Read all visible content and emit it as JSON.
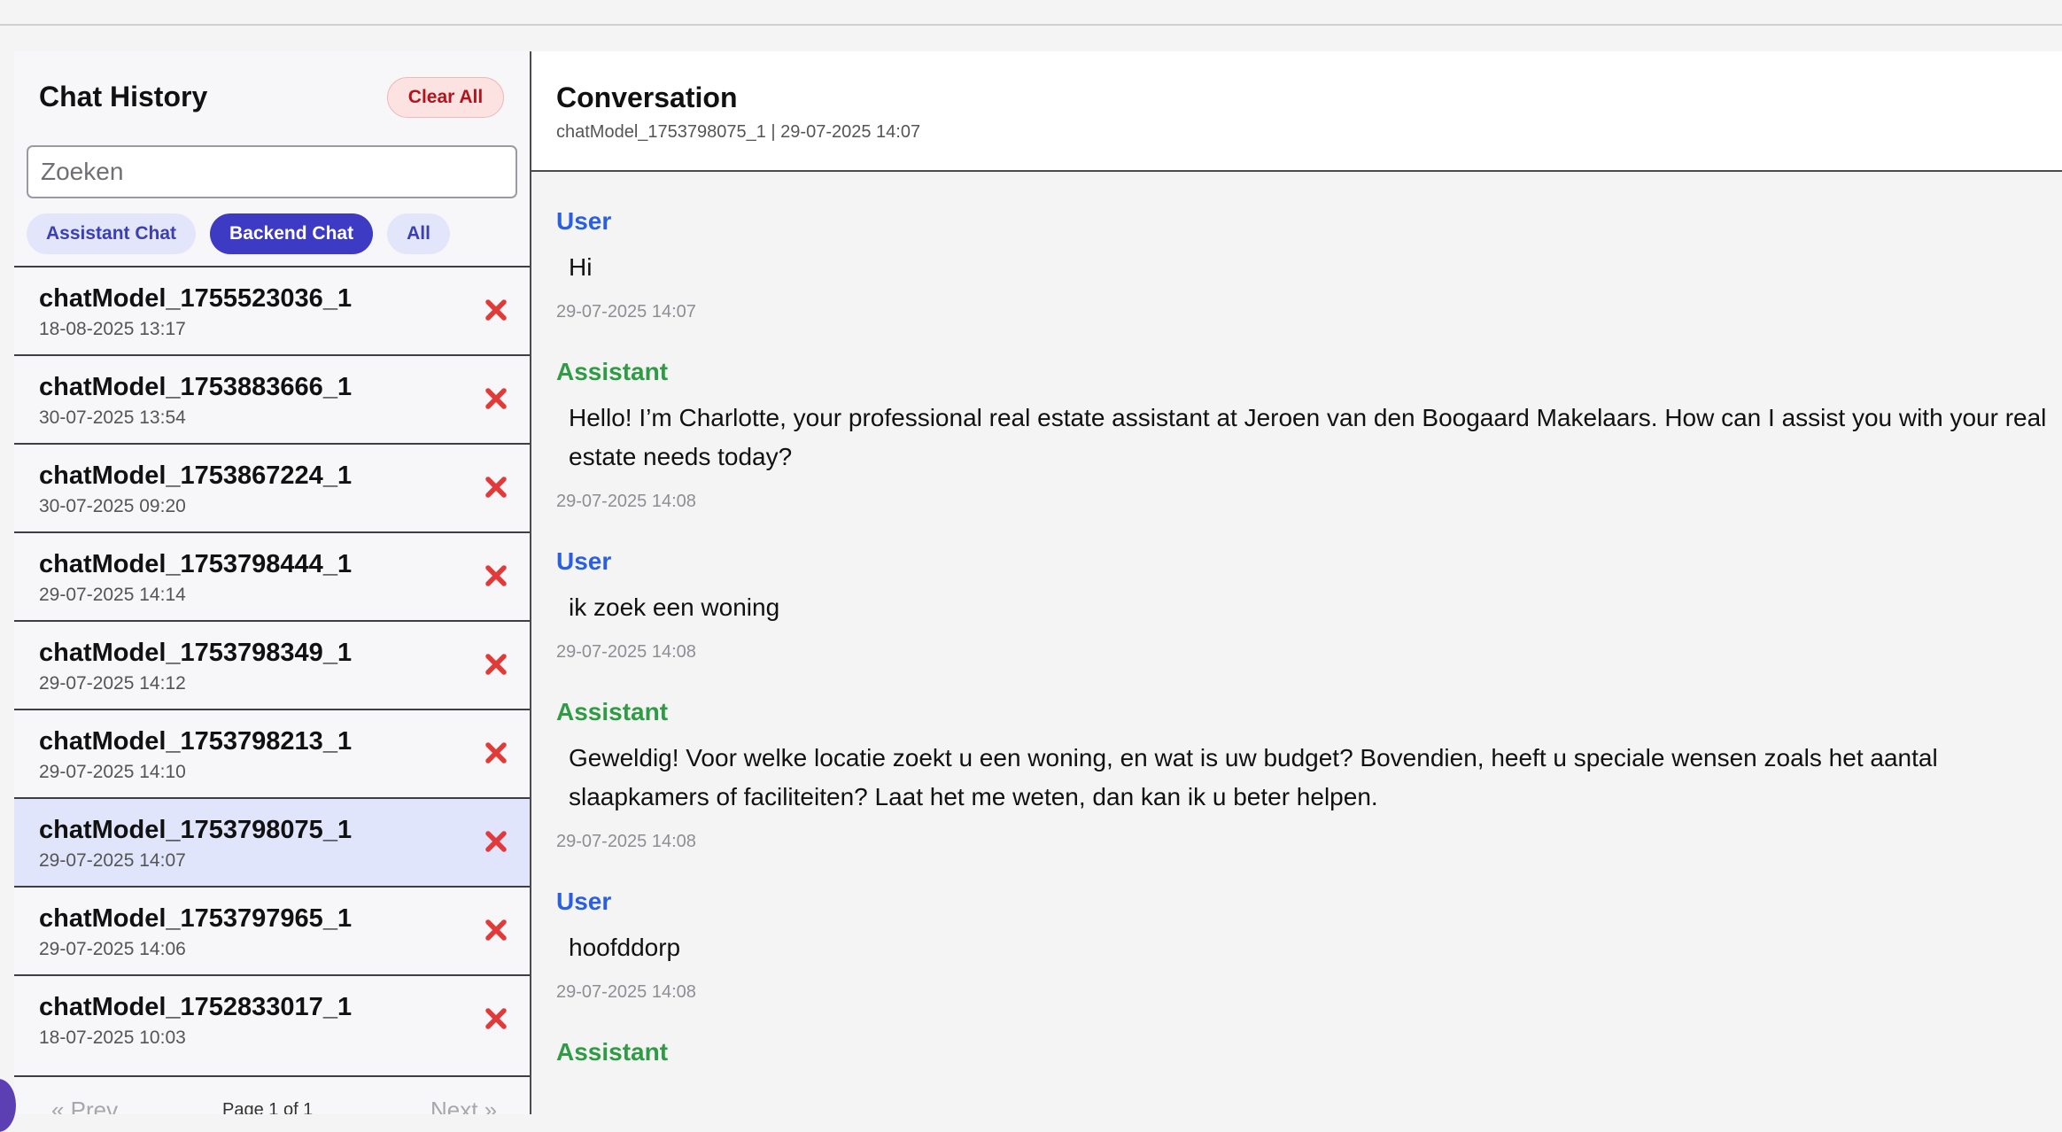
{
  "sidebar": {
    "title": "Chat History",
    "clear_all_label": "Clear All",
    "search_placeholder": "Zoeken",
    "filters": [
      {
        "label": "Assistant Chat",
        "active": false
      },
      {
        "label": "Backend Chat",
        "active": true
      },
      {
        "label": "All",
        "active": false
      }
    ],
    "chats": [
      {
        "name": "chatModel_1755523036_1",
        "date": "18-08-2025 13:17",
        "selected": false
      },
      {
        "name": "chatModel_1753883666_1",
        "date": "30-07-2025 13:54",
        "selected": false
      },
      {
        "name": "chatModel_1753867224_1",
        "date": "30-07-2025 09:20",
        "selected": false
      },
      {
        "name": "chatModel_1753798444_1",
        "date": "29-07-2025 14:14",
        "selected": false
      },
      {
        "name": "chatModel_1753798349_1",
        "date": "29-07-2025 14:12",
        "selected": false
      },
      {
        "name": "chatModel_1753798213_1",
        "date": "29-07-2025 14:10",
        "selected": false
      },
      {
        "name": "chatModel_1753798075_1",
        "date": "29-07-2025 14:07",
        "selected": true
      },
      {
        "name": "chatModel_1753797965_1",
        "date": "29-07-2025 14:06",
        "selected": false
      },
      {
        "name": "chatModel_1752833017_1",
        "date": "18-07-2025 10:03",
        "selected": false
      }
    ],
    "pagination": {
      "prev_label": "« Prev",
      "page_label": "Page 1 of 1",
      "next_label": "Next »"
    }
  },
  "conversation": {
    "title": "Conversation",
    "subtitle": "chatModel_1753798075_1 | 29-07-2025 14:07",
    "messages": [
      {
        "role": "User",
        "type": "user",
        "text": "Hi",
        "time": "29-07-2025 14:07"
      },
      {
        "role": "Assistant",
        "type": "assistant",
        "text": "Hello! I’m Charlotte, your professional real estate assistant at Jeroen van den Boogaard Makelaars. How can I assist you with your real estate needs today?",
        "time": "29-07-2025 14:08"
      },
      {
        "role": "User",
        "type": "user",
        "text": "ik zoek een woning",
        "time": "29-07-2025 14:08"
      },
      {
        "role": "Assistant",
        "type": "assistant",
        "text": "Geweldig! Voor welke locatie zoekt u een woning, en wat is uw budget? Bovendien, heeft u speciale wensen zoals het aantal slaapkamers of faciliteiten? Laat het me weten, dan kan ik u beter helpen.",
        "time": "29-07-2025 14:08"
      },
      {
        "role": "User",
        "type": "user",
        "text": "hoofddorp",
        "time": "29-07-2025 14:08"
      },
      {
        "role": "Assistant",
        "type": "assistant",
        "text": "",
        "time": ""
      }
    ]
  },
  "colors": {
    "accent": "#3d3bc4",
    "user_role": "#2a5fe0",
    "assistant_role": "#2f9b44",
    "delete": "#e03a3a"
  },
  "icons": {
    "delete": "close-icon"
  }
}
